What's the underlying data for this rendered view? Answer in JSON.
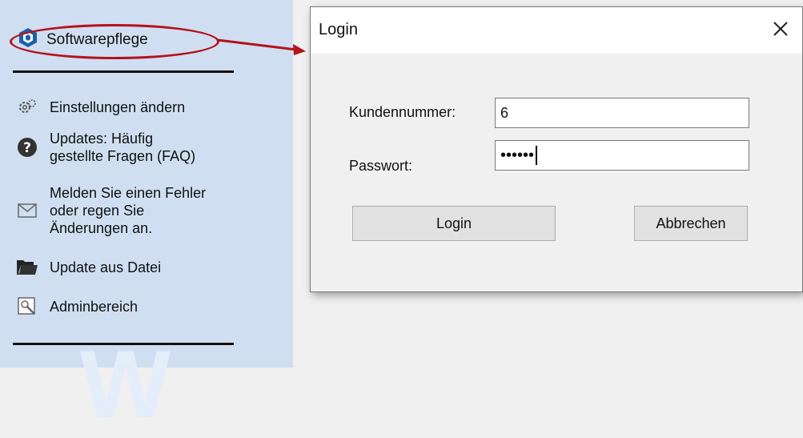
{
  "sidebar": {
    "top_item": {
      "label": "Softwarepflege",
      "icon": "software-care-icon"
    },
    "items": [
      {
        "lines": [
          "Einstellungen ändern"
        ],
        "icon": "gear-icon"
      },
      {
        "lines": [
          "Updates: Häufig",
          "gestellte Fragen (FAQ)"
        ],
        "icon": "question-icon"
      },
      {
        "lines": [
          "Melden Sie einen Fehler",
          "oder regen Sie",
          "Änderungen an."
        ],
        "icon": "mail-icon"
      },
      {
        "lines": [
          "Update aus Datei"
        ],
        "icon": "folder-icon"
      },
      {
        "lines": [
          "Adminbereich"
        ],
        "icon": "admin-icon"
      }
    ],
    "watermark_letter": "W",
    "highlight_color": "#b5121b"
  },
  "dialog": {
    "title": "Login",
    "close_symbol": "✕",
    "fields": {
      "customer_label": "Kundennummer:",
      "customer_value": "6",
      "password_label": "Passwort:",
      "password_value": "••••••"
    },
    "buttons": {
      "login": "Login",
      "cancel": "Abbrechen"
    }
  }
}
